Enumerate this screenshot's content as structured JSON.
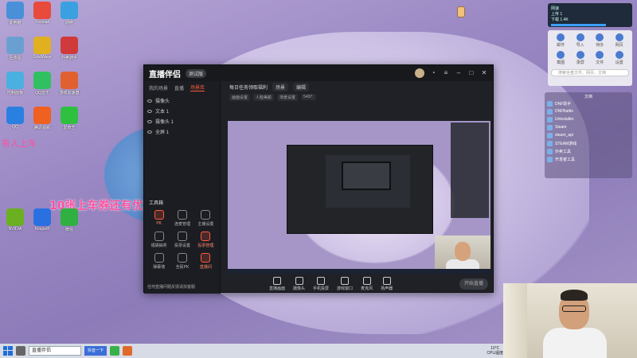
{
  "wallpaper": {
    "promo_text": "10张上车券还有优惠",
    "promo_text2": "有人上车"
  },
  "desktop_icons": [
    {
      "label": "此电脑",
      "color": "#4a90d9"
    },
    {
      "label": "Foxmail",
      "color": "#e84a3c"
    },
    {
      "label": "网络",
      "color": "#3aa0e0"
    },
    {
      "label": "回收站",
      "color": "#6aa0d0"
    },
    {
      "label": "GoldWave",
      "color": "#e0b020"
    },
    {
      "label": "外卖骑手",
      "color": "#d03a3a"
    },
    {
      "label": "控制面板",
      "color": "#4ab0e0"
    },
    {
      "label": "QQ音乐",
      "color": "#30c060"
    },
    {
      "label": "游戏加速器",
      "color": "#e06030"
    },
    {
      "label": "QQ",
      "color": "#2a80e0"
    },
    {
      "label": "腾讯视频",
      "color": "#f06020"
    },
    {
      "label": "爱奇艺",
      "color": "#30c040"
    },
    {
      "label": "NVIDIA",
      "color": "#6ab020"
    },
    {
      "label": "Kingsoft",
      "color": "#2a70e0"
    },
    {
      "label": "微信",
      "color": "#30b040"
    }
  ],
  "app": {
    "logo": "直播伴侣",
    "version_badge": "测试版",
    "tabs": [
      "我的场景",
      "直播",
      "场景库"
    ],
    "active_tab_index": 2,
    "layers": [
      "摄像头",
      "文本 1",
      "摄像头 1",
      "全屏 1"
    ],
    "tools_header": "工具箱",
    "tools": [
      {
        "label": "PK",
        "hot": true
      },
      {
        "label": "连麦管理",
        "hot": false
      },
      {
        "label": "主播设置",
        "hot": false
      },
      {
        "label": "福袋抽奖",
        "hot": false
      },
      {
        "label": "投票设置",
        "hot": false
      },
      {
        "label": "投票管理",
        "hot": true
      },
      {
        "label": "弹幕墙",
        "hot": false
      },
      {
        "label": "全民PK",
        "hot": false
      },
      {
        "label": "直播间",
        "hot": true
      }
    ],
    "footer_hint": "任何直播问题反馈请找客服",
    "top_title": "每日任务领取福利",
    "top_pill": "场景",
    "top_pill2": "编辑",
    "sub_items": [
      "画面设置",
      "人脸美颜",
      "场景设置",
      "5497:"
    ],
    "bottom_tools": [
      "直播画面",
      "摄像头",
      "手机投屏",
      "游戏窗口",
      "麦克风",
      "扬声器"
    ],
    "start_live_label": "开始直播"
  },
  "net_widget": {
    "title": "网速",
    "line1": "上传 1",
    "line2": "下载 1.4K"
  },
  "quick_panel": {
    "items": [
      "邮件",
      "导入",
      "待办",
      "网页",
      "截图",
      "录屏",
      "文件",
      "设置"
    ],
    "search_placeholder": "搜索全盘文件、网页、文档"
  },
  "file_panel": {
    "title": "文档",
    "files": [
      "DNF助手",
      "DNFBattle",
      "Uninstaller",
      "Steam",
      "steam_api",
      "STEAM游戏",
      "外卖工具",
      "开发者工具"
    ]
  },
  "taskbar": {
    "search_text": "直播伴侣",
    "app_button": "抖音一下",
    "weather": "10°C",
    "cpu": "CPU温度"
  }
}
